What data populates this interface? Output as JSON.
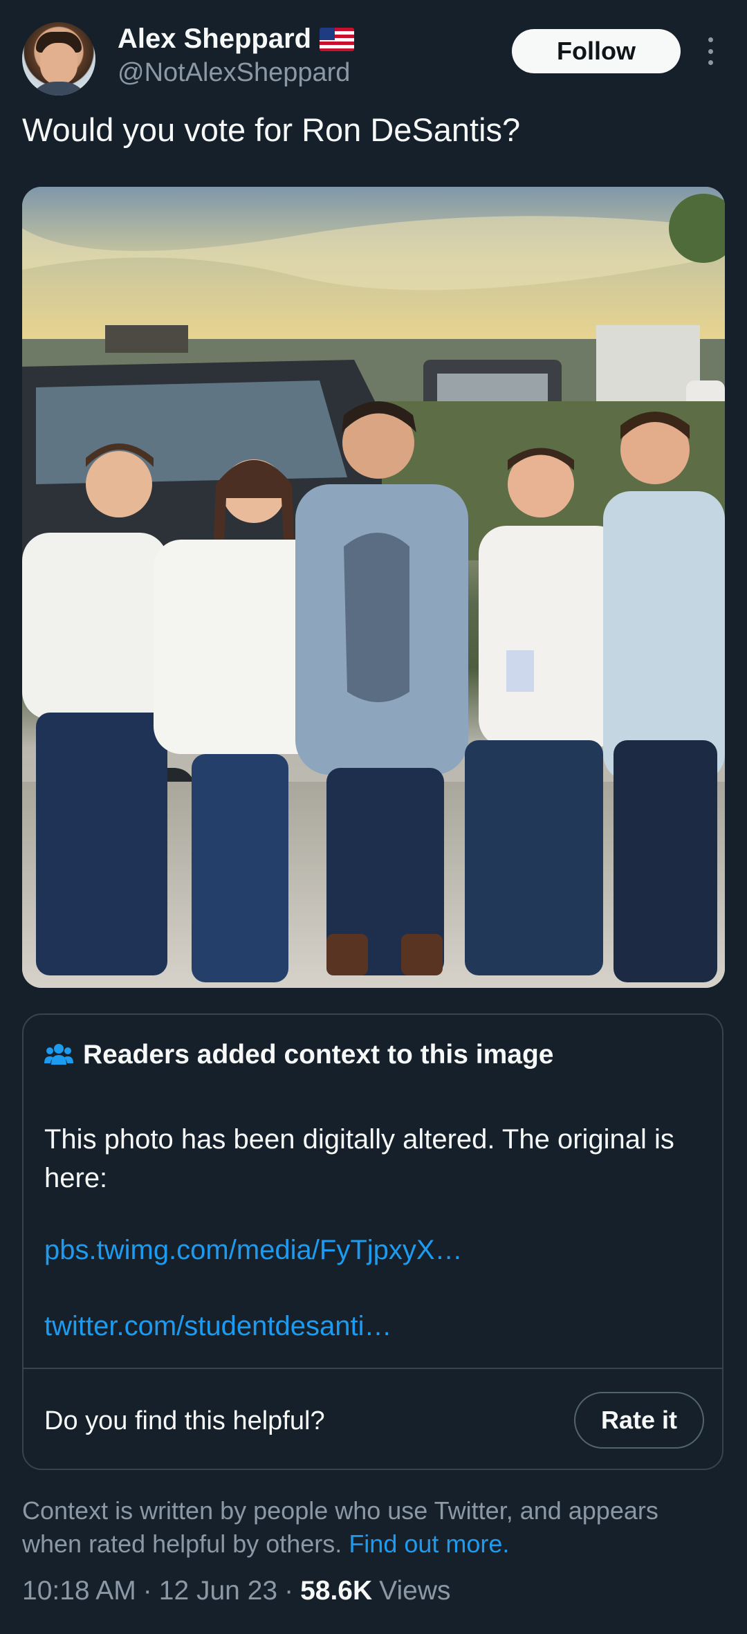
{
  "author": {
    "display_name": "Alex Sheppard",
    "handle": "@NotAlexSheppard",
    "flag_icon": "us-flag-icon"
  },
  "follow_label": "Follow",
  "tweet": {
    "text": "Would you vote for Ron DeSantis?"
  },
  "community_note": {
    "title": "Readers added context to this image",
    "body": "This photo has been digitally altered. The original is here:",
    "links": [
      "pbs.twimg.com/media/FyTjpxyX…",
      "twitter.com/studentdesanti…"
    ],
    "helpful_question": "Do you find this helpful?",
    "rate_label": "Rate it"
  },
  "footer": {
    "note": "Context is written by people who use Twitter, and appears when rated helpful by others.",
    "find_out_more": "Find out more."
  },
  "meta": {
    "time": "10:18 AM",
    "date": "12 Jun 23",
    "views_count": "58.6K",
    "views_label": "Views"
  },
  "colors": {
    "background": "#15202b",
    "accent_link": "#1d9bf0",
    "secondary_text": "#8b98a5",
    "border": "#38444d"
  }
}
